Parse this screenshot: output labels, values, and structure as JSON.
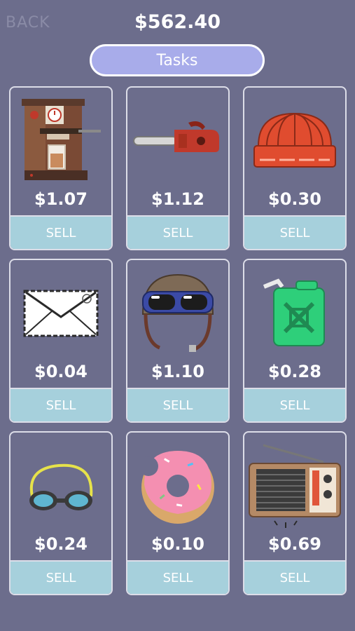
{
  "header": {
    "back_label": "BACK",
    "balance": "$562.40",
    "tasks_label": "Tasks"
  },
  "items": [
    {
      "name": "coffee-machine",
      "price": "$1.07",
      "sell_label": "SELL"
    },
    {
      "name": "chainsaw",
      "price": "$1.12",
      "sell_label": "SELL"
    },
    {
      "name": "beanie",
      "price": "$0.30",
      "sell_label": "SELL"
    },
    {
      "name": "envelope",
      "price": "$0.04",
      "sell_label": "SELL"
    },
    {
      "name": "aviator-helmet",
      "price": "$1.10",
      "sell_label": "SELL"
    },
    {
      "name": "jerrycan",
      "price": "$0.28",
      "sell_label": "SELL"
    },
    {
      "name": "swim-goggles",
      "price": "$0.24",
      "sell_label": "SELL"
    },
    {
      "name": "donut",
      "price": "$0.10",
      "sell_label": "SELL"
    },
    {
      "name": "radio",
      "price": "$0.69",
      "sell_label": "SELL"
    }
  ]
}
